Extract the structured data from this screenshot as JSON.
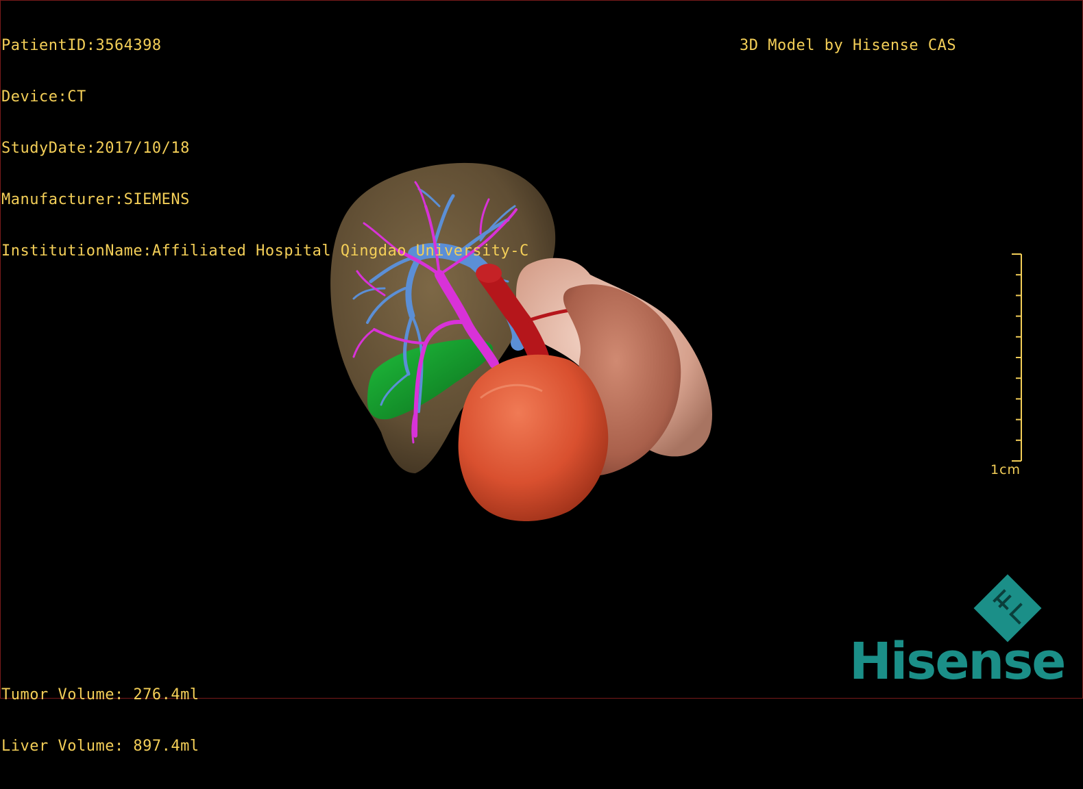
{
  "header_left": {
    "patient_id": "PatientID:3564398",
    "device": "Device:CT",
    "study_date": "StudyDate:2017/10/18",
    "manufacturer": "Manufacturer:SIEMENS",
    "institution": "InstitutionName:Affiliated Hospital Qingdao University-C"
  },
  "header_right": {
    "credit": "3D Model by Hisense CAS"
  },
  "footer_left": {
    "tumor_volume": "Tumor Volume: 276.4ml",
    "liver_volume": "Liver Volume: 897.4ml"
  },
  "scale": {
    "label": "1cm",
    "tick_count": 11
  },
  "brand": {
    "wordmark": "Hisense",
    "color": "#1b8f88"
  },
  "colors": {
    "overlay_text": "#f4cf58",
    "liver": "#6e5a3c",
    "tumor": "#e2583a",
    "kidney": "#dcaa98",
    "spleen": "#b86d58",
    "portal_vein": "#5b8fd6",
    "hepatic_artery": "#d832d8",
    "aorta": "#b5161b",
    "gallbladder": "#129a2a"
  }
}
